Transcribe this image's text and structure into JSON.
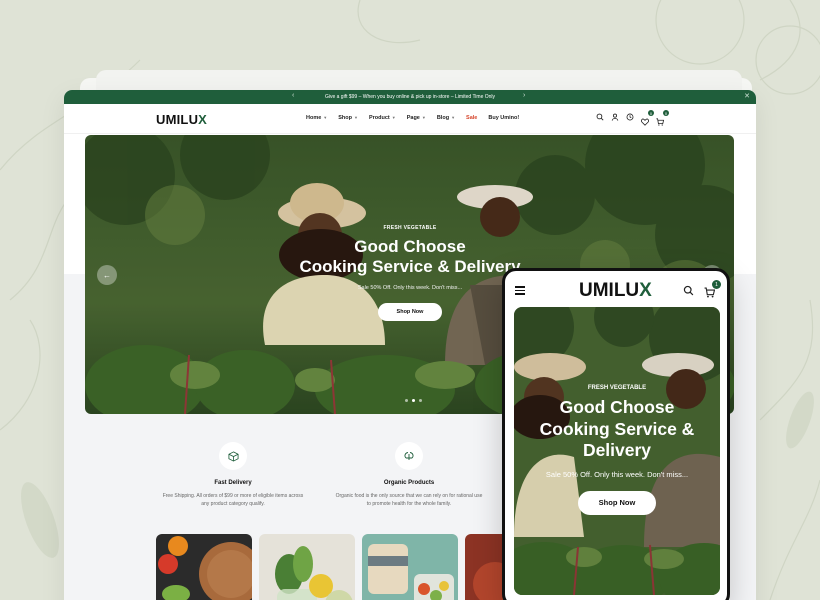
{
  "announcement": {
    "text": "Give a gift $99 – When you buy online & pick up in-store – Limited Time Only",
    "prev_icon": "chevron-left-icon",
    "next_icon": "chevron-right-icon",
    "close_icon": "close-icon"
  },
  "header": {
    "logo": {
      "main": "UMILU",
      "accent": "X"
    },
    "menu": [
      {
        "label": "Home",
        "has_dropdown": true
      },
      {
        "label": "Shop",
        "has_dropdown": true
      },
      {
        "label": "Product",
        "has_dropdown": true
      },
      {
        "label": "Page",
        "has_dropdown": true
      },
      {
        "label": "Blog",
        "has_dropdown": true
      },
      {
        "label": "Sale",
        "has_dropdown": false
      },
      {
        "label": "Buy Umino!",
        "has_dropdown": false
      }
    ],
    "icons": [
      "search-icon",
      "user-icon",
      "compare-icon",
      "wishlist-icon",
      "cart-icon"
    ],
    "wishlist_count": "0",
    "cart_count": "0"
  },
  "hero": {
    "eyebrow": "FRESH VEGETABLE",
    "title_line1": "Good Choose",
    "title_line2": "Cooking Service & Delivery",
    "subtitle": "Sale 50% Off. Only this week. Don't miss...",
    "button": "Shop Now"
  },
  "features": [
    {
      "icon": "box-icon",
      "title": "Fast Delivery",
      "desc_line1": "Free Shipping. All orders of $99 or more of eligible items across",
      "desc_line2": "any product category qualify."
    },
    {
      "icon": "leaf-recycle-icon",
      "title": "Organic Products",
      "desc_line1": "Organic food is the only source that we can rely on for rational use",
      "desc_line2": "to promote health for the whole family."
    }
  ],
  "mobile": {
    "logo": {
      "main": "UMILU",
      "accent": "X"
    },
    "cart_count": "1",
    "eyebrow": "FRESH VEGETABLE",
    "title_line1": "Good Choose",
    "title_line2": "Cooking Service &",
    "title_line3": "Delivery",
    "subtitle": "Sale 50% Off. Only this week. Don't miss...",
    "button": "Shop Now"
  },
  "colors": {
    "brand_green": "#1f5e3b",
    "sale_red": "#d6452b",
    "backdrop": "#dfe3d6"
  }
}
